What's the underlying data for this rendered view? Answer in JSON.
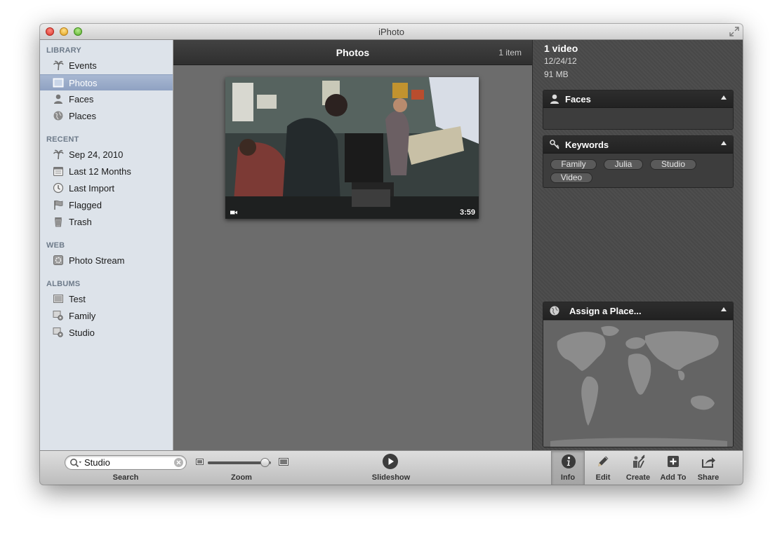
{
  "window": {
    "title": "iPhoto"
  },
  "sidebar": {
    "sections": [
      {
        "header": "LIBRARY",
        "items": [
          {
            "label": "Events",
            "icon": "palm-tree-icon"
          },
          {
            "label": "Photos",
            "icon": "photos-icon",
            "selected": true
          },
          {
            "label": "Faces",
            "icon": "person-icon"
          },
          {
            "label": "Places",
            "icon": "globe-icon"
          }
        ]
      },
      {
        "header": "RECENT",
        "items": [
          {
            "label": "Sep 24, 2010",
            "icon": "palm-tree-icon"
          },
          {
            "label": "Last 12 Months",
            "icon": "calendar-icon"
          },
          {
            "label": "Last Import",
            "icon": "clock-icon"
          },
          {
            "label": "Flagged",
            "icon": "flag-icon"
          },
          {
            "label": "Trash",
            "icon": "trash-icon"
          }
        ]
      },
      {
        "header": "WEB",
        "items": [
          {
            "label": "Photo Stream",
            "icon": "photo-stream-icon"
          }
        ]
      },
      {
        "header": "ALBUMS",
        "items": [
          {
            "label": "Test",
            "icon": "album-icon"
          },
          {
            "label": "Family",
            "icon": "smart-album-icon"
          },
          {
            "label": "Studio",
            "icon": "smart-album-icon"
          }
        ]
      }
    ]
  },
  "content": {
    "title": "Photos",
    "count": "1 item",
    "video_duration": "3:59"
  },
  "info": {
    "title": "1 video",
    "date": "12/24/12",
    "size": "91 MB",
    "faces_label": "Faces",
    "keywords_label": "Keywords",
    "keywords": [
      "Family",
      "Julia",
      "Studio",
      "Video"
    ],
    "place_label": "Assign a Place..."
  },
  "toolbar": {
    "search_value": "Studio",
    "search_label": "Search",
    "zoom_label": "Zoom",
    "zoom_level": 0.9,
    "slideshow_label": "Slideshow",
    "buttons": [
      {
        "label": "Info",
        "icon": "info-icon",
        "active": true
      },
      {
        "label": "Edit",
        "icon": "pencil-icon"
      },
      {
        "label": "Create",
        "icon": "create-icon"
      },
      {
        "label": "Add To",
        "icon": "add-icon"
      },
      {
        "label": "Share",
        "icon": "share-icon"
      }
    ]
  },
  "colors": {
    "sidebar_bg": "#dde3ea",
    "selection": "#97a9c8",
    "content_bg": "#6c6c6c",
    "panel_bg": "#3d3d3d"
  }
}
